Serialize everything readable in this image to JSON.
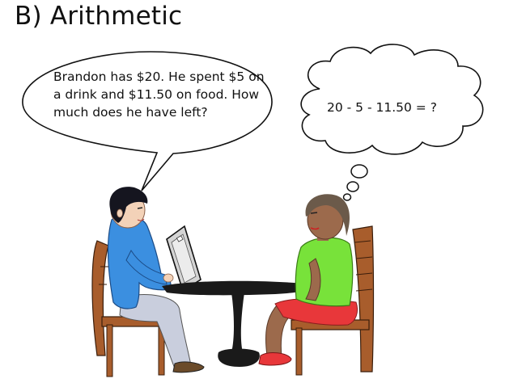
{
  "title": "B) Arithmetic",
  "speech": {
    "text": "Brandon has $20. He spent $5 on a drink and $11.50 on food. How much does he have left?"
  },
  "thought": {
    "text": "20 - 5 - 11.50 = ?"
  },
  "colors": {
    "boy_shirt": "#3b8fe0",
    "boy_pants": "#c9cedd",
    "girl_shirt": "#78e23a",
    "girl_shorts": "#e8373a",
    "girl_skin": "#9c6a4c",
    "girl_hair": "#6b5a4a",
    "chair": "#a85d2c",
    "table": "#1a1a1a",
    "boy_hair": "#15151f"
  }
}
